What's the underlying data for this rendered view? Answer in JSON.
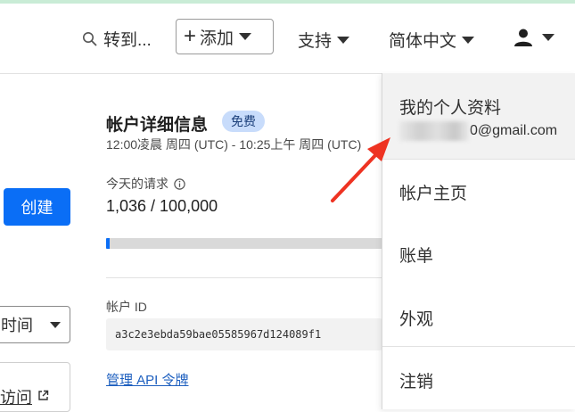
{
  "header": {
    "search_label": "转到...",
    "add_label": "添加",
    "support_label": "支持",
    "language_label": "简体中文"
  },
  "left": {
    "create_label": "创建",
    "select_value": "时间",
    "access_label": "访问"
  },
  "account": {
    "title": "帐户详细信息",
    "plan_badge": "免费",
    "time_range": "12:00凌晨 周四 (UTC) - 10:25上午 周四 (UTC)",
    "requests_label": "今天的请求",
    "requests_value": "1,036 / 100,000",
    "requests_fraction": 0.01036,
    "account_id_label": "帐户 ID",
    "account_id": "a3c2e3ebda59bae05585967d124089f1",
    "api_link": "管理 API 令牌"
  },
  "user_menu": {
    "profile_title": "我的个人资料",
    "email_suffix": "0@gmail.com",
    "items": [
      "帐户主页",
      "账单",
      "外观",
      "注销"
    ]
  },
  "colors": {
    "accent": "#0a6ef6",
    "badge_bg": "#c8dcfb",
    "annotation_arrow": "#ee3322"
  }
}
